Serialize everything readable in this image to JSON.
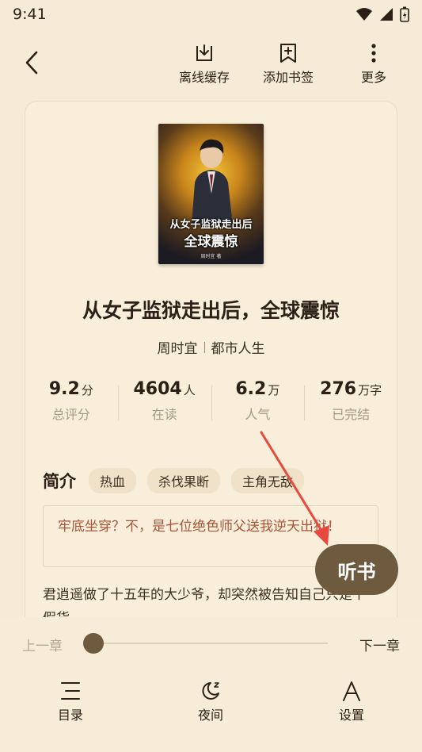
{
  "status_bar": {
    "time": "9:41"
  },
  "topbar": {
    "offline_cache": "离线缓存",
    "add_bookmark": "添加书签",
    "more": "更多"
  },
  "book": {
    "cover_title_line1": "从女子监狱走出后",
    "cover_title_line2": "全球震惊",
    "cover_author": "周时宜 著",
    "title": "从女子监狱走出后，全球震惊",
    "author": "周时宜",
    "category": "都市人生"
  },
  "stats": [
    {
      "value": "9.2",
      "unit": "分",
      "label": "总评分"
    },
    {
      "value": "4604",
      "unit": "人",
      "label": "在读"
    },
    {
      "value": "6.2",
      "unit": "万",
      "label": "人气"
    },
    {
      "value": "276",
      "unit": "万字",
      "label": "已完结"
    }
  ],
  "intro": {
    "title": "简介",
    "tags": [
      "热血",
      "杀伐果断",
      "主角无敌"
    ],
    "quote": "牢底坐穿？不，是七位绝色师父送我逆天出狱！",
    "description": "君逍遥做了十五年的大少爷，却突然被告知自己只是个假货……"
  },
  "listen_button": "听书",
  "chapter_nav": {
    "prev": "上一章",
    "next": "下一章",
    "progress": 0
  },
  "bottom_nav": {
    "toc": "目录",
    "night": "夜间",
    "settings": "设置"
  },
  "colors": {
    "background": "#f6ebd6",
    "accent": "#6d5a3f",
    "quote_text": "#a8543a",
    "arrow": "#e8493f"
  }
}
